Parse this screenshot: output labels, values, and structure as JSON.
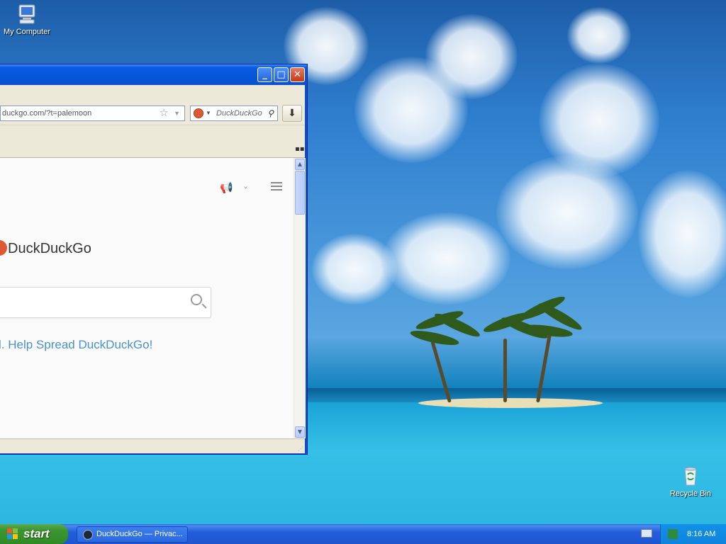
{
  "desktop": {
    "icons": [
      {
        "label": "My Computer",
        "icon": "my-computer-icon"
      },
      {
        "label": "Recycle Bin",
        "icon": "recycle-bin-icon"
      }
    ]
  },
  "browser": {
    "url": "duckgo.com/?t=palemoon",
    "search_engine_label": "DuckDuckGo",
    "titlebar_buttons": [
      "minimize",
      "maximize",
      "close"
    ]
  },
  "page": {
    "brand": "DuckDuckGo",
    "search_placeholder": "",
    "promo": "l. Help Spread DuckDuckGo!"
  },
  "taskbar": {
    "start_label": "start",
    "task_label": "DuckDuckGo — Privac...",
    "clock": "8:16 AM"
  },
  "colors": {
    "xp_blue": "#0a4fd6",
    "start_green": "#3d9532",
    "ddg_orange": "#de5833",
    "promo_link": "#4a91c8"
  }
}
